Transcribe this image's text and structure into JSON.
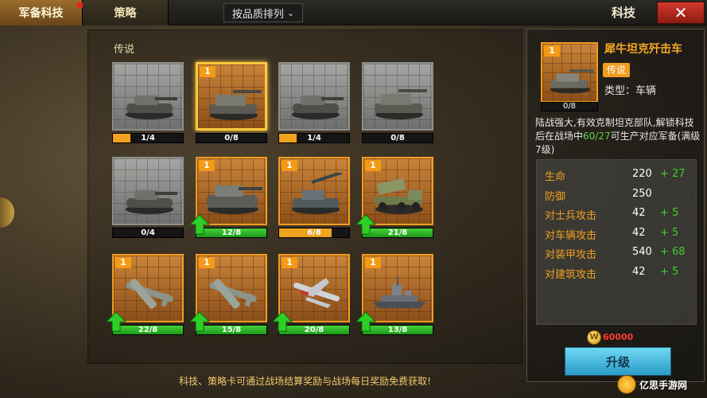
{
  "tabs": [
    {
      "label": "军备科技",
      "active": true,
      "has_notification": true
    },
    {
      "label": "策略",
      "active": false
    }
  ],
  "sort": {
    "label": "按品质排列"
  },
  "header_title": "科技",
  "section_title": "传说",
  "cards": [
    {
      "name": "tank-1",
      "progress_text": "1/4",
      "progress": 0.25,
      "level": null,
      "style": "gray",
      "upgradable": false,
      "selected": false,
      "icon": "tank"
    },
    {
      "name": "tank-2",
      "progress_text": "0/8",
      "progress": 0,
      "level": "1",
      "style": "orange",
      "upgradable": false,
      "selected": true,
      "icon": "tank-destroyer"
    },
    {
      "name": "tank-3",
      "progress_text": "1/4",
      "progress": 0.25,
      "level": null,
      "style": "gray",
      "upgradable": false,
      "selected": false,
      "icon": "tank"
    },
    {
      "name": "tank-4",
      "progress_text": "0/8",
      "progress": 0,
      "level": null,
      "style": "gray",
      "upgradable": false,
      "selected": false,
      "icon": "tank-destroyer"
    },
    {
      "name": "tank-5",
      "progress_text": "0/4",
      "progress": 0,
      "level": null,
      "style": "gray",
      "upgradable": false,
      "selected": false,
      "icon": "tank"
    },
    {
      "name": "tank-6",
      "progress_text": "12/8",
      "progress": 1,
      "level": "1",
      "style": "orange",
      "upgradable": true,
      "selected": false,
      "icon": "heavy-tank"
    },
    {
      "name": "tank-7",
      "progress_text": "6/8",
      "progress": 0.75,
      "level": "1",
      "style": "orange",
      "upgradable": false,
      "selected": false,
      "icon": "artillery"
    },
    {
      "name": "truck-8",
      "progress_text": "21/8",
      "progress": 1,
      "level": "1",
      "style": "orange",
      "upgradable": true,
      "selected": false,
      "icon": "rocket-truck"
    },
    {
      "name": "plane-9",
      "progress_text": "22/8",
      "progress": 1,
      "level": "1",
      "style": "orange",
      "upgradable": true,
      "selected": false,
      "icon": "bomber"
    },
    {
      "name": "plane-10",
      "progress_text": "15/8",
      "progress": 1,
      "level": "1",
      "style": "orange",
      "upgradable": true,
      "selected": false,
      "icon": "bomber"
    },
    {
      "name": "plane-11",
      "progress_text": "20/8",
      "progress": 1,
      "level": "1",
      "style": "orange",
      "upgradable": true,
      "selected": false,
      "icon": "jet"
    },
    {
      "name": "ship-12",
      "progress_text": "13/8",
      "progress": 1,
      "level": "1",
      "style": "orange",
      "upgradable": true,
      "selected": false,
      "icon": "battleship"
    }
  ],
  "tip": "科技、策略卡可通过战场结算奖励与战场每日奖励免费获取!",
  "detail": {
    "name": "犀牛坦克歼击车",
    "level": "1",
    "progress_text": "0/8",
    "rarity": "传说",
    "type": "类型：车辆",
    "desc_pre": "陆战强大,有效克制坦克部队,解锁科技后在战场中",
    "desc_highlight": "60/27",
    "desc_post": "可生产对应军备(满级7级)",
    "stats": [
      {
        "label": "生命",
        "value": "220",
        "bonus": "+ 27"
      },
      {
        "label": "防御",
        "value": "250",
        "bonus": ""
      },
      {
        "label": "对士兵攻击",
        "value": "42",
        "bonus": "+ 5"
      },
      {
        "label": "对车辆攻击",
        "value": "42",
        "bonus": "+ 5"
      },
      {
        "label": "对装甲攻击",
        "value": "540",
        "bonus": "+ 68"
      },
      {
        "label": "对建筑攻击",
        "value": "42",
        "bonus": "+ 5"
      }
    ],
    "cost_coin_label": "W",
    "cost": "60000",
    "upgrade_label": "升级"
  },
  "watermark": "亿思手游网",
  "colors": {
    "accent_orange": "#f29c1e",
    "bonus_green": "#3fce2c",
    "close_red": "#d23a2a",
    "upgrade_blue": "#2a9bc8"
  }
}
